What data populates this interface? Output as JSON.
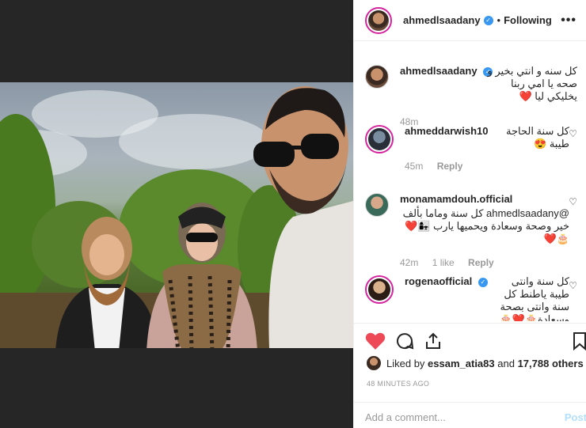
{
  "header": {
    "username": "ahmedlsaadany",
    "separator": "•",
    "follow_status": "Following",
    "more_label": "•••"
  },
  "comments": [
    {
      "username": "ahmedlsaadany",
      "verified": true,
      "text": "كل سنه و انتي بخير و صحه يا امي ربنا يخليكي ليا ❤️",
      "time": "48m",
      "likes": "",
      "reply": ""
    },
    {
      "username": "ahmeddarwish10",
      "verified": false,
      "text": "كل سنة الحاجة طيبة 😍",
      "time": "45m",
      "likes": "",
      "reply": "Reply"
    },
    {
      "username": "monamamdouh.official",
      "verified": false,
      "text": "@ahmedlsaadany كل سنة وماما بألف خير وصحة وسعادة ويحميها يارب 👩‍👧❤️🎂❤️",
      "time": "42m",
      "likes": "1 like",
      "reply": "Reply"
    },
    {
      "username": "rogenaofficial",
      "verified": true,
      "text": "كل سنة وانتى طيبة ياطنط كل سنة وانتى بصحة وسعادة🎂❤️🎂❤️🎂❤️🎂",
      "time": "",
      "likes": "",
      "reply": ""
    }
  ],
  "likes_line": {
    "prefix": "Liked by",
    "user": "essam_atia83",
    "and": "and",
    "count": "17,788 others"
  },
  "time_ago": "48 MINUTES AGO",
  "add_comment": {
    "placeholder": "Add a comment...",
    "post_label": "Post"
  },
  "colors": {
    "accent": "#3897f0",
    "like": "#ed4956",
    "post": "#b2dffc"
  }
}
